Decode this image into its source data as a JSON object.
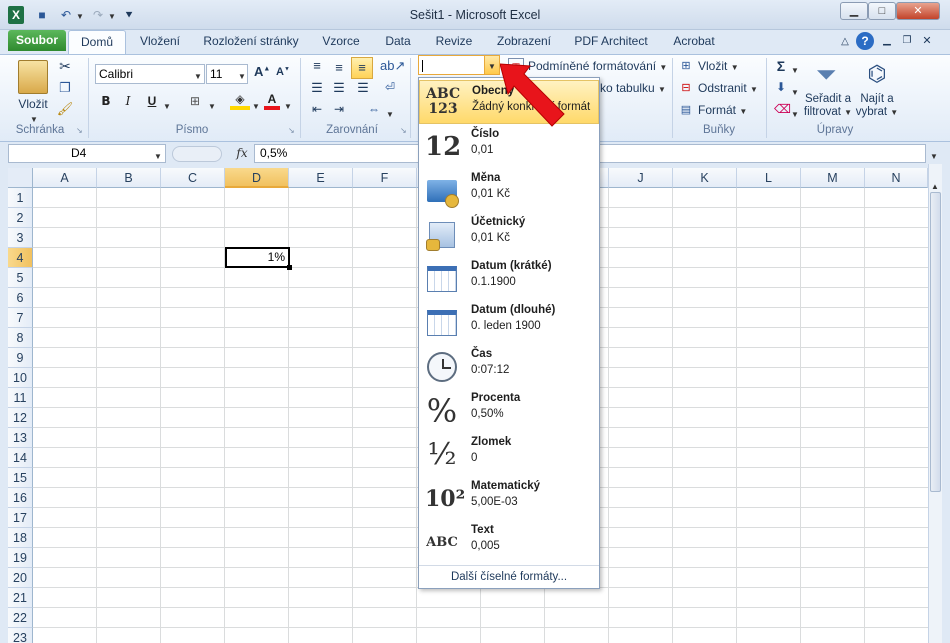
{
  "window": {
    "title": "Sešit1 - Microsoft Excel"
  },
  "tabs": {
    "file": "Soubor",
    "home": "Domů",
    "insert": "Vložení",
    "layout": "Rozložení stránky",
    "formulas": "Vzorce",
    "data": "Data",
    "review": "Revize",
    "view": "Zobrazení",
    "pdf": "PDF Architect",
    "acrobat": "Acrobat"
  },
  "ribbon": {
    "clipboard": {
      "label": "Schránka",
      "paste": "Vložit"
    },
    "font": {
      "label": "Písmo",
      "name": "Calibri",
      "size": "11",
      "bold": "B",
      "italic": "I",
      "underline": "U"
    },
    "alignment": {
      "label": "Zarovnání"
    },
    "number": {
      "format_value": ""
    },
    "styles": {
      "conditional": "Podmíněné formátování",
      "table": "ko tabulku"
    },
    "cells": {
      "label": "Buňky",
      "insert": "Vložit",
      "delete": "Odstranit",
      "format": "Formát"
    },
    "editing": {
      "label": "Úpravy",
      "sort": "Seřadit a filtrovat",
      "sort1": "Seřadit a",
      "sort2": "filtrovat",
      "find1": "Najít a",
      "find2": "vybrat"
    }
  },
  "formula_bar": {
    "name_box": "D4",
    "fx": "fx",
    "value": "0,5%"
  },
  "grid": {
    "columns": [
      "A",
      "B",
      "C",
      "D",
      "E",
      "F",
      "G",
      "H",
      "I",
      "J",
      "K",
      "L",
      "M",
      "N"
    ],
    "rows": [
      "1",
      "2",
      "3",
      "4",
      "5",
      "6",
      "7",
      "8",
      "9",
      "10",
      "11",
      "12",
      "13",
      "14",
      "15",
      "16",
      "17",
      "18",
      "19",
      "20",
      "21",
      "22",
      "23"
    ],
    "active_cell": "D4",
    "d4_value": "1%"
  },
  "number_formats": [
    {
      "name": "Obecný",
      "example": "Žádný konkrétní formát",
      "icon_text": "ABC 123",
      "icon": "general-format-icon"
    },
    {
      "name": "Číslo",
      "example": "0,01",
      "icon_text": "12",
      "icon": "number-format-icon"
    },
    {
      "name": "Měna",
      "example": "0,01 Kč",
      "icon_text": "",
      "icon": "currency-format-icon"
    },
    {
      "name": "Účetnický",
      "example": " 0,01 Kč",
      "icon_text": "",
      "icon": "accounting-format-icon"
    },
    {
      "name": "Datum (krátké)",
      "example": "0.1.1900",
      "icon_text": "",
      "icon": "short-date-icon"
    },
    {
      "name": "Datum (dlouhé)",
      "example": "0. leden 1900",
      "icon_text": "",
      "icon": "long-date-icon"
    },
    {
      "name": "Čas",
      "example": "0:07:12",
      "icon_text": "",
      "icon": "clock-icon"
    },
    {
      "name": "Procenta",
      "example": "0,50%",
      "icon_text": "%",
      "icon": "percent-icon"
    },
    {
      "name": "Zlomek",
      "example": "0",
      "icon_text": "½",
      "icon": "fraction-icon"
    },
    {
      "name": "Matematický",
      "example": "5,00E-03",
      "icon_text": "10²",
      "icon": "scientific-icon"
    },
    {
      "name": "Text",
      "example": "0,005",
      "icon_text": "ABC",
      "icon": "text-format-icon"
    }
  ],
  "more_formats": "Další číselné formáty...",
  "colors": {
    "accent": "#2f8a2f",
    "highlight": "#ffd96a",
    "arrow": "#e8141b"
  }
}
